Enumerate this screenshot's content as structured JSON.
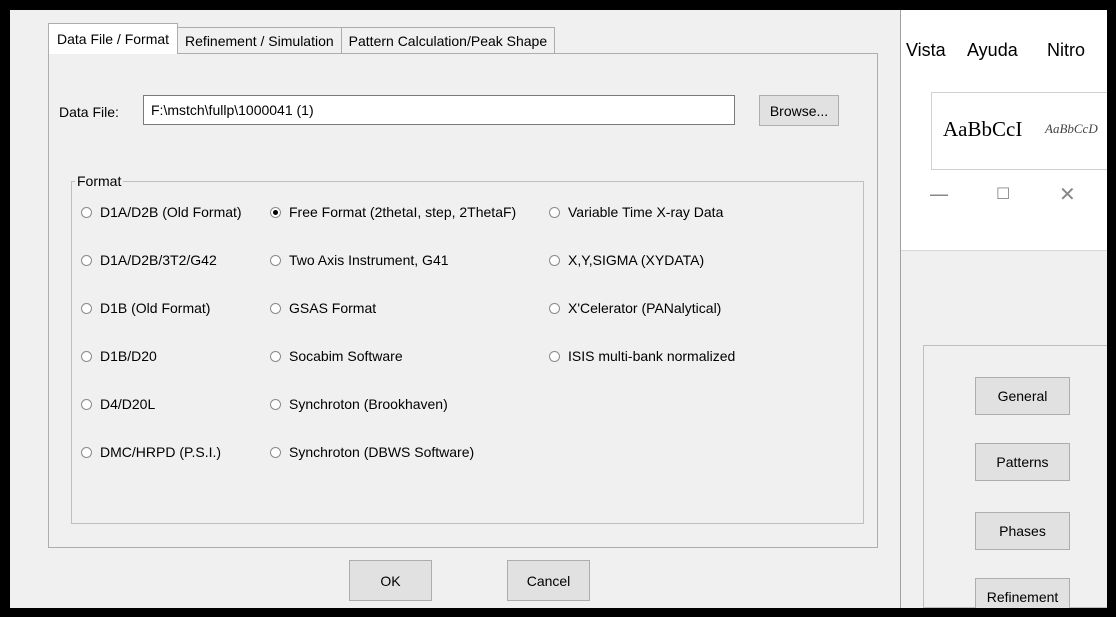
{
  "dialog": {
    "tabs": [
      "Data File / Format",
      "Refinement / Simulation",
      "Pattern Calculation/Peak Shape"
    ],
    "data_file_label": "Data File:",
    "data_file_value": "F:\\mstch\\fullp\\1000041 (1)",
    "browse_label": "Browse...",
    "format_legend": "Format",
    "formats": {
      "col1": [
        "D1A/D2B (Old Format)",
        "D1A/D2B/3T2/G42",
        "D1B (Old Format)",
        "D1B/D20",
        "D4/D20L",
        "DMC/HRPD (P.S.I.)"
      ],
      "col2": [
        "Free Format (2thetaI, step, 2ThetaF)",
        "Two Axis Instrument, G41",
        "GSAS Format",
        "Socabim Software",
        "Synchroton (Brookhaven)",
        "Synchroton (DBWS Software)"
      ],
      "col3": [
        "Variable Time X-ray Data",
        "X,Y,SIGMA (XYDATA)",
        "X'Celerator (PANalytical)",
        "ISIS multi-bank normalized"
      ]
    },
    "selected_format": "Free Format (2thetaI, step, 2ThetaF)",
    "ok_label": "OK",
    "cancel_label": "Cancel"
  },
  "background_window": {
    "menu": [
      "Vista",
      "Ayuda",
      "Nitro"
    ],
    "style_sample_main": "AaBbCcI",
    "style_sample_italic": "AaBbCcD",
    "side_buttons": [
      "General",
      "Patterns",
      "Phases",
      "Refinement"
    ]
  }
}
